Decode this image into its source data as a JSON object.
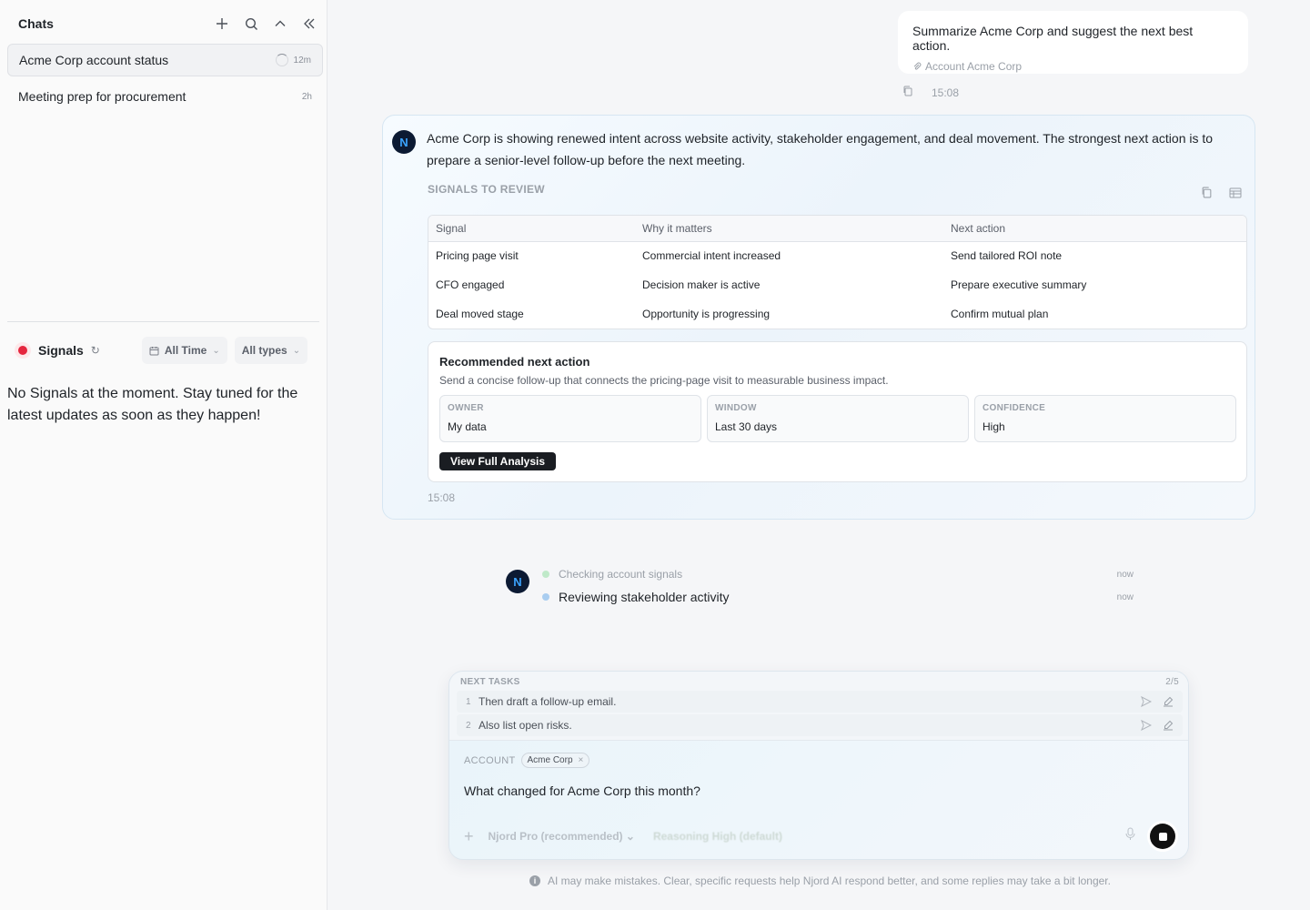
{
  "sidebar": {
    "title": "Chats",
    "chats": [
      {
        "label": "Acme Corp account status",
        "time": "12m"
      },
      {
        "label": "Meeting prep for procurement",
        "time": "2h"
      }
    ],
    "signals": {
      "label": "Signals",
      "refresh_glyph": "↻",
      "time_filter": "All Time",
      "type_filter": "All types",
      "empty_message": "No Signals at the moment. Stay tuned for the latest updates as soon as they happen!"
    }
  },
  "user_message": {
    "text": "Summarize Acme Corp and suggest the next best action.",
    "attachment": "Account Acme Corp",
    "time": "15:08"
  },
  "ai_message": {
    "avatar": "N",
    "text": "Acme Corp is showing renewed intent across website activity, stakeholder engagement, and deal movement. The strongest next action is to prepare a senior-level follow-up before the next meeting.",
    "section_label": "SIGNALS TO REVIEW",
    "table": {
      "headers": [
        "Signal",
        "Why it matters",
        "Next action"
      ],
      "rows": [
        [
          "Pricing page visit",
          "Commercial intent increased",
          "Send tailored ROI note"
        ],
        [
          "CFO engaged",
          "Decision maker is active",
          "Prepare executive summary"
        ],
        [
          "Deal moved stage",
          "Opportunity is progressing",
          "Confirm mutual plan"
        ]
      ]
    },
    "recommendation": {
      "title": "Recommended next action",
      "subtitle": "Send a concise follow-up that connects the pricing-page visit to measurable business impact.",
      "owner_label": "OWNER",
      "owner": "My data",
      "window_label": "WINDOW",
      "window": "Last 30 days",
      "confidence_label": "CONFIDENCE",
      "confidence": "High",
      "button": "View Full Analysis"
    },
    "time": "15:08"
  },
  "progress": {
    "avatar": "N",
    "steps": [
      {
        "text": "Checking account signals",
        "time": "now",
        "color": "#bfe9c9"
      },
      {
        "text": "Reviewing stakeholder activity",
        "time": "now",
        "color": "#a9cdf0"
      }
    ]
  },
  "composer": {
    "tasks_label": "NEXT TASKS",
    "tasks_count": "2/5",
    "tasks": [
      {
        "num": "1",
        "text": "Then draft a follow-up email."
      },
      {
        "num": "2",
        "text": "Also list open risks."
      }
    ],
    "account_label": "ACCOUNT",
    "account_chip": "Acme Corp",
    "query": "What changed for Acme Corp this month?",
    "model": "Njord Pro (recommended)",
    "reasoning": "Reasoning High (default)"
  },
  "disclaimer": "AI may make mistakes. Clear, specific requests help Njord AI respond better, and some replies may take a bit longer."
}
